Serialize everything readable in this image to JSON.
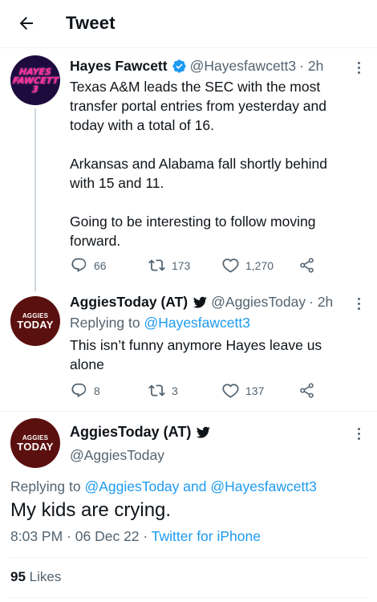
{
  "header": {
    "title": "Tweet",
    "back_icon": "arrow-left-icon"
  },
  "tweets": [
    {
      "name": "Hayes Fawcett",
      "handle": "@Hayesfawcett3",
      "time": "· 2h",
      "verified_badge": "verified-badge-icon",
      "avatar_text": [
        "HAYES",
        "FAWCETT",
        "3"
      ],
      "text": "Texas A&M leads the SEC with the most transfer portal entries from yesterday and today with a total of 16.\n\nArkansas and Alabama fall shortly behind with 15 and 11.\n\nGoing to be interesting to follow moving forward.",
      "replies": "66",
      "retweets": "173",
      "likes": "1,270"
    },
    {
      "name": "AggiesToday (AT)",
      "handle": "@AggiesToday",
      "time": "· 2h",
      "avatar_text": [
        "AGGIES",
        "TODAY"
      ],
      "replying_prefix": "Replying to",
      "replying_to": "@Hayesfawcett3",
      "text": "This isn’t funny anymore Hayes leave us alone",
      "replies": "8",
      "retweets": "3",
      "likes": "137"
    }
  ],
  "main_tweet": {
    "name": "AggiesToday (AT)",
    "handle": "@AggiesToday",
    "avatar_text": [
      "AGGIES",
      "TODAY"
    ],
    "replying_prefix": "Replying to",
    "replying_to_1": "@AggiesToday",
    "replying_and": "and",
    "replying_to_2": "@Hayesfawcett3",
    "text": "My kids are crying.",
    "time": "8:03 PM",
    "date": "06 Dec 22",
    "dot": "·",
    "source": "Twitter for iPhone",
    "likes_count": "95",
    "likes_label": "Likes"
  },
  "colors": {
    "accent": "#1d9bf0",
    "text": "#0f1419",
    "muted": "#536471",
    "divider": "#eff3f4",
    "like_red": "#f91880",
    "aggies_maroon": "#5b1010",
    "hayes_bg": "#1d0b3e",
    "hayes_pink": "#ff2e9a"
  }
}
